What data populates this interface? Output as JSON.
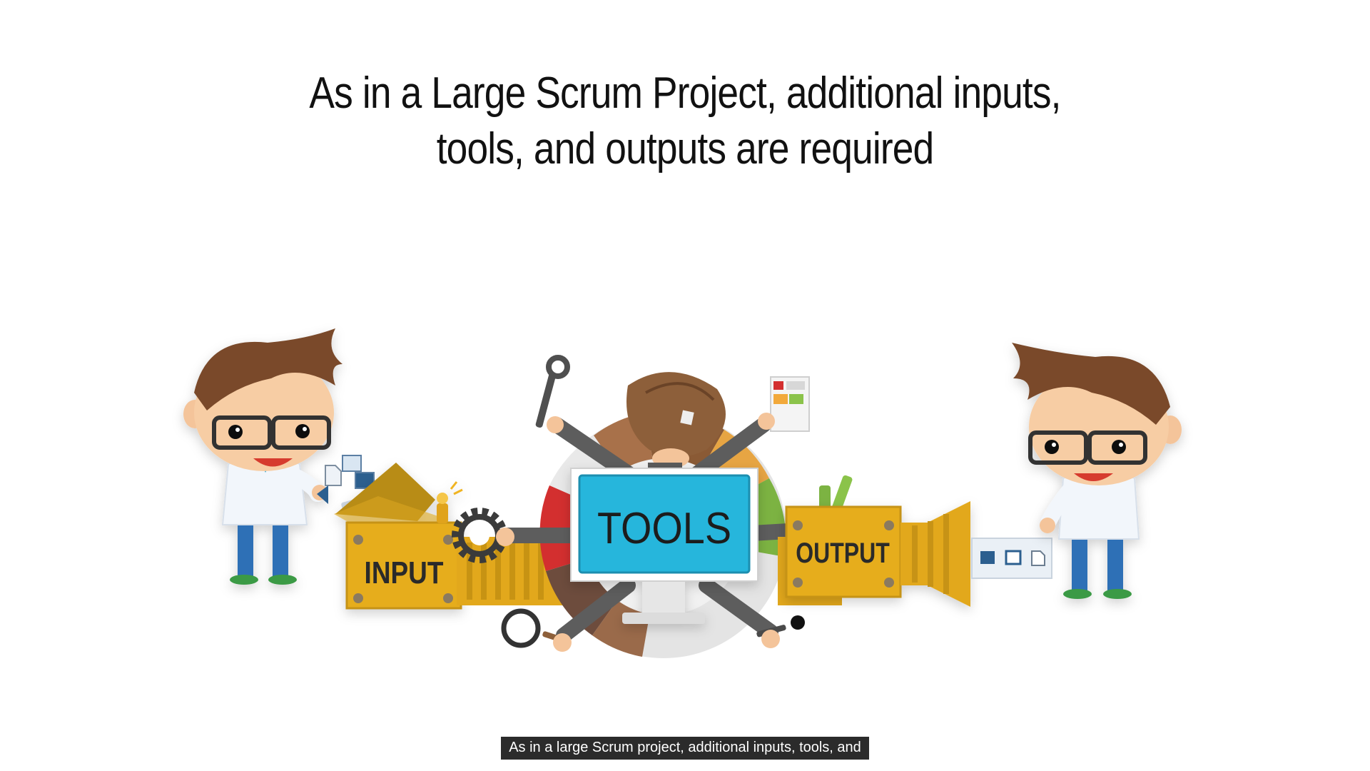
{
  "slide": {
    "title_line1": "As in a Large Scrum Project, additional inputs,",
    "title_line2": "tools, and outputs are required"
  },
  "diagram": {
    "input_label": "INPUT",
    "tools_label": "TOOLS",
    "output_label": "OUTPUT"
  },
  "subtitle": {
    "text": "As in a large Scrum project, additional inputs, tools, and"
  }
}
